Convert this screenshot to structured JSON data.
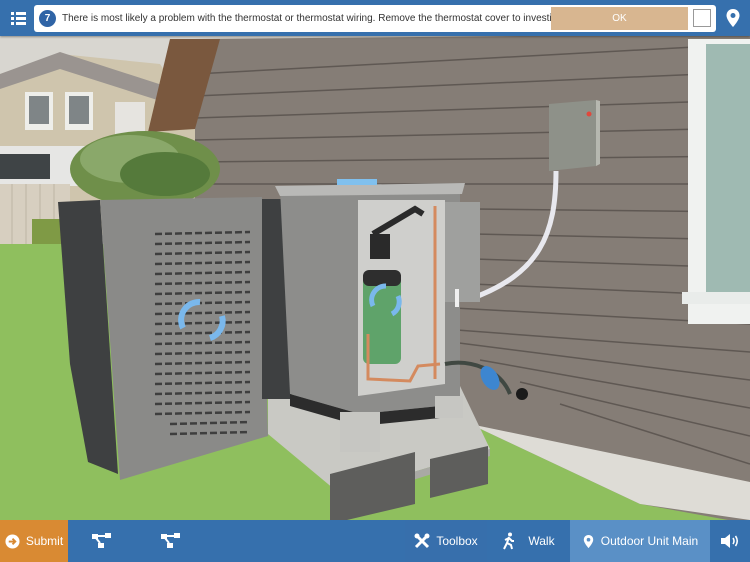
{
  "header": {
    "menu_icon": "list-icon",
    "step_number": "7",
    "message": "There is most likely a problem with the thermostat or thermostat wiring. Remove the thermostat cover to investigate.",
    "ok_label": "OK",
    "checkbox_checked": false,
    "location_icon": "map-pin-icon"
  },
  "footer": {
    "submit_label": "Submit",
    "submit_icon": "arrow-right-circle-icon",
    "graph_buttons": [
      {
        "icon": "hierarchy-icon"
      },
      {
        "icon": "hierarchy-icon"
      }
    ],
    "toolbox_label": "Toolbox",
    "toolbox_icon": "tools-icon",
    "walk_label": "Walk",
    "walk_icon": "walking-person-icon",
    "location_label": "Outdoor Unit Main",
    "location_icon": "map-pin-icon",
    "sound_icon": "speaker-icon"
  },
  "scene": {
    "description": "3D view of outdoor HVAC condenser unit with side panel removed, beside house siding with disconnect box",
    "colors": {
      "grass": "#8fbf5e",
      "siding": "#857d76",
      "unit_panel": "#8a8a88",
      "compressor": "#5fa36a",
      "rotate_arrows": "#7ab8ec",
      "accent_blue": "#3670ad",
      "submit_orange": "#d98a33",
      "ok_tan": "#d8b690"
    }
  }
}
